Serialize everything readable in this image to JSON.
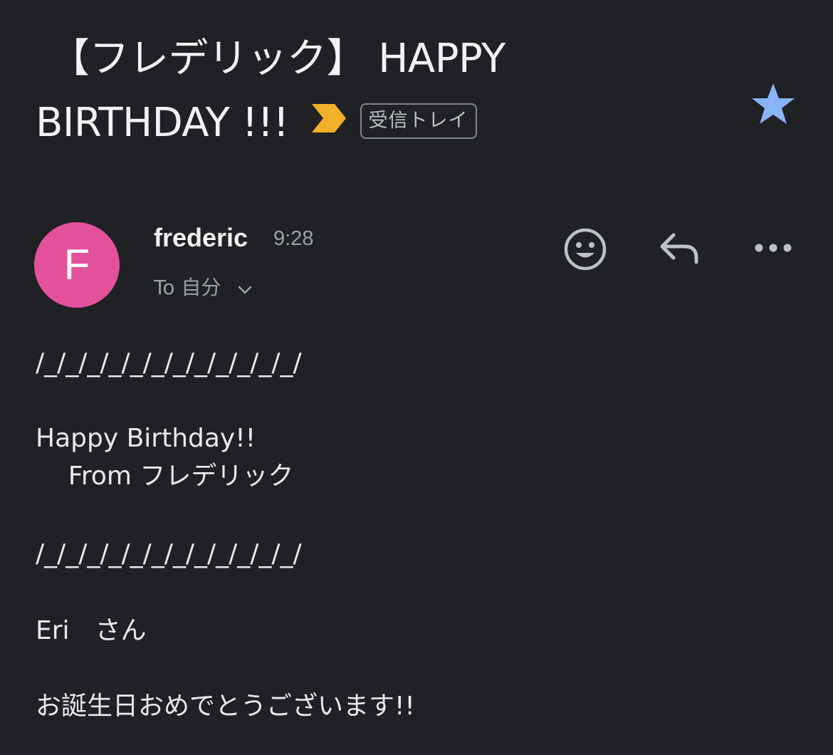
{
  "email": {
    "subject_line1": "【フレデリック】 HAPPY",
    "subject_line2": "BIRTHDAY !!!",
    "importance_icon": "importance-marker-icon",
    "label": "受信トレイ",
    "starred": true,
    "star_color": "#8ab4f8",
    "importance_color": "#f2b12a"
  },
  "sender": {
    "avatar_letter": "F",
    "avatar_color": "#e3519b",
    "name": "frederic",
    "time": "9:28",
    "recipient": "To 自分"
  },
  "actions": {
    "emoji_icon": "emoji-reaction-icon",
    "reply_icon": "reply-icon",
    "more_icon": "more-options-icon"
  },
  "body": {
    "divider_top": "/_/_/_/_/_/_/_/_/_/_/_/_/",
    "greeting": "Happy Birthday!!",
    "from_line": "    From フレデリック",
    "divider_bottom": "/_/_/_/_/_/_/_/_/_/_/_/_/",
    "addressee": "Eri　さん",
    "message": "お誕生日おめでとうございます!!"
  }
}
